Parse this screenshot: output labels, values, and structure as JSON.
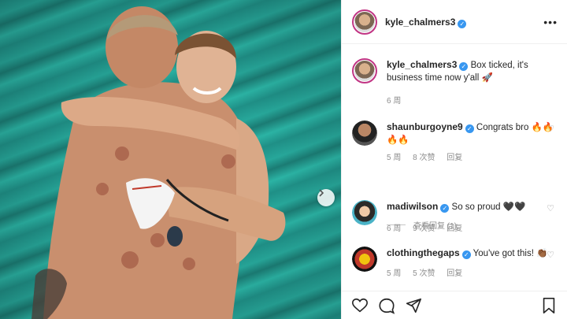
{
  "post": {
    "username": "kyle_chalmers3",
    "verified": true,
    "caption_user": "kyle_chalmers3",
    "caption_text": "Box ticked, it's business time now y'all 🚀",
    "caption_time": "6 周"
  },
  "comments": [
    {
      "username": "shaunburgoyne9",
      "text": "Congrats bro 🔥🔥🔥🔥",
      "time": "5 周",
      "likes": "8 次赞",
      "reply": "回复",
      "view_replies": "查看回复 (1)"
    },
    {
      "username": "madiwilson",
      "text": "So so proud 🖤🖤",
      "time": "6 周",
      "likes": "9 次赞",
      "reply": "回复"
    },
    {
      "username": "clothingthegaps",
      "text": "You've got this! 👏🏾",
      "time": "5 周",
      "likes": "5 次赞",
      "reply": "回复"
    }
  ],
  "icons": [
    "more-options-icon",
    "like-icon",
    "comment-icon",
    "share-icon",
    "save-icon",
    "next-arrow-icon",
    "verified-icon"
  ],
  "colors": {
    "verified": "#3897f0",
    "meta": "#8e8e8e",
    "pool": "#27a79a"
  }
}
